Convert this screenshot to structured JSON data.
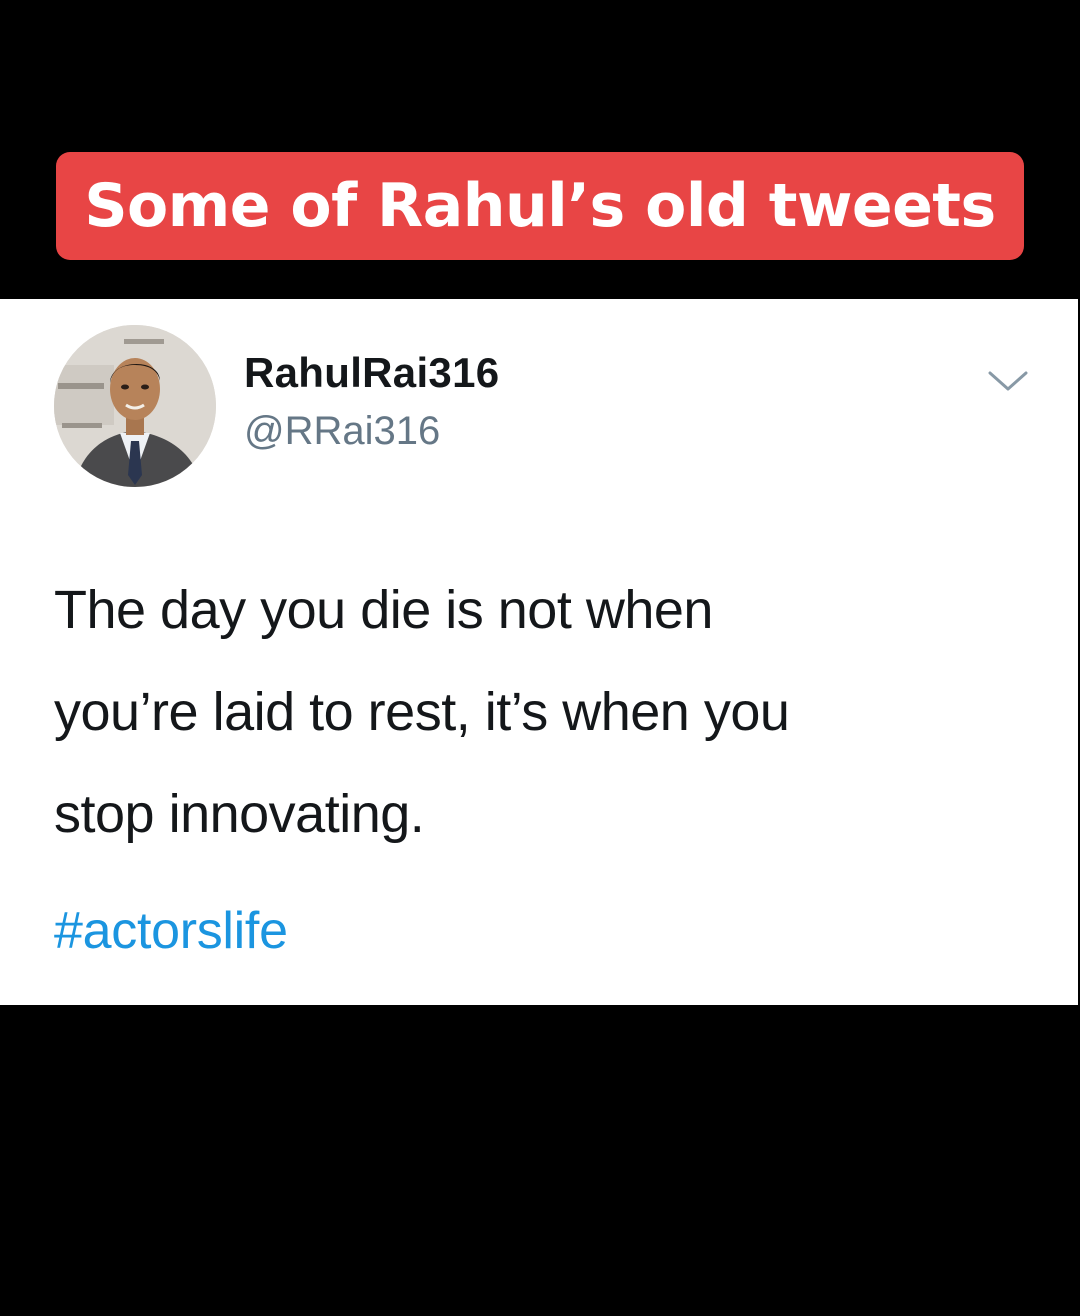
{
  "caption": {
    "text": "Some of Rahul’s old tweets",
    "background_color": "#e84545"
  },
  "tweet": {
    "display_name": "RahulRai316",
    "handle": "@RRai316",
    "text_lines": [
      "The day you die is not when",
      "you’re laid to rest, it’s when you",
      "stop innovating."
    ],
    "hashtag": "#actorslife",
    "hashtag_color": "#1b95e0",
    "menu_icon": "chevron-down-icon",
    "avatar_icon": "profile-photo"
  }
}
